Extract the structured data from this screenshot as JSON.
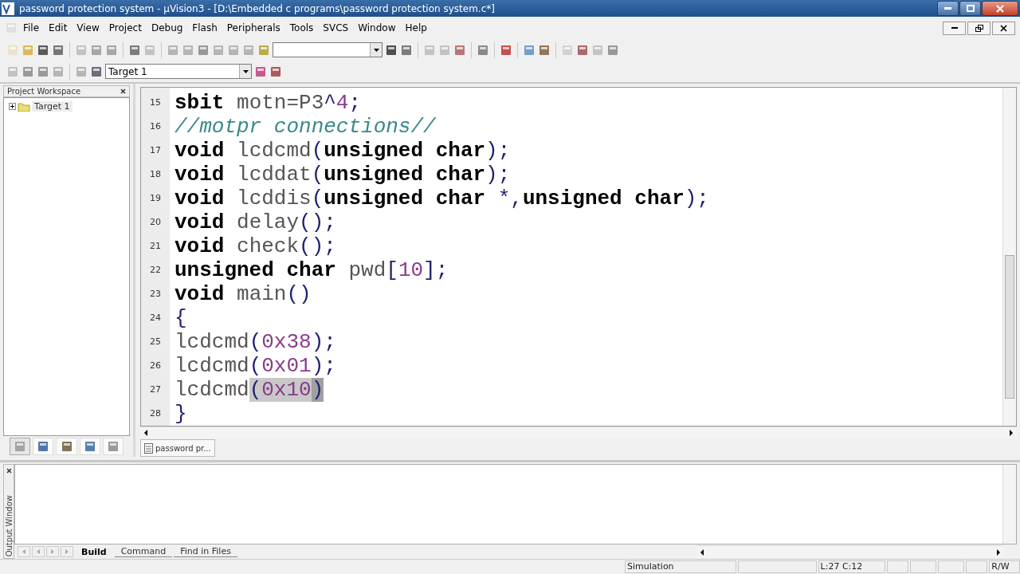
{
  "window": {
    "title": "password protection system  - µVision3 - [D:\\Embedded c programs\\password protection system.c*]"
  },
  "menu": [
    "File",
    "Edit",
    "View",
    "Project",
    "Debug",
    "Flash",
    "Peripherals",
    "Tools",
    "SVCS",
    "Window",
    "Help"
  ],
  "toolbar": {
    "target_select": {
      "value": "Target 1"
    }
  },
  "project_workspace": {
    "title": "Project Workspace",
    "tree": [
      {
        "label": "Target 1",
        "expanded": false
      }
    ],
    "tabs": [
      {
        "kind": "files",
        "selected": true
      },
      {
        "kind": "regs",
        "selected": false
      },
      {
        "kind": "books",
        "selected": false
      },
      {
        "kind": "functions",
        "selected": false
      },
      {
        "kind": "templates",
        "selected": false
      }
    ]
  },
  "editor": {
    "lines": [
      {
        "number": "15",
        "tokens": [
          {
            "text": "sbit",
            "kind": "kw"
          },
          {
            "text": " motn=P3",
            "kind": "id"
          },
          {
            "text": "^",
            "kind": "op"
          },
          {
            "text": "4",
            "kind": "num"
          },
          {
            "text": ";",
            "kind": "op"
          }
        ]
      },
      {
        "number": "16",
        "tokens": [
          {
            "text": "//motpr connections//",
            "kind": "comment"
          }
        ]
      },
      {
        "number": "17",
        "tokens": [
          {
            "text": "void",
            "kind": "kw"
          },
          {
            "text": " lcdcmd",
            "kind": "id"
          },
          {
            "text": "(",
            "kind": "op"
          },
          {
            "text": "unsigned char",
            "kind": "kw"
          },
          {
            "text": ");",
            "kind": "op"
          }
        ]
      },
      {
        "number": "18",
        "tokens": [
          {
            "text": "void",
            "kind": "kw"
          },
          {
            "text": " lcddat",
            "kind": "id"
          },
          {
            "text": "(",
            "kind": "op"
          },
          {
            "text": "unsigned char",
            "kind": "kw"
          },
          {
            "text": ");",
            "kind": "op"
          }
        ]
      },
      {
        "number": "19",
        "tokens": [
          {
            "text": "void",
            "kind": "kw"
          },
          {
            "text": " lcddis",
            "kind": "id"
          },
          {
            "text": "(",
            "kind": "op"
          },
          {
            "text": "unsigned char",
            "kind": "kw"
          },
          {
            "text": " *,",
            "kind": "op"
          },
          {
            "text": "unsigned char",
            "kind": "kw"
          },
          {
            "text": ");",
            "kind": "op"
          }
        ]
      },
      {
        "number": "20",
        "tokens": [
          {
            "text": "void",
            "kind": "kw"
          },
          {
            "text": " delay",
            "kind": "id"
          },
          {
            "text": "();",
            "kind": "op"
          }
        ]
      },
      {
        "number": "21",
        "tokens": [
          {
            "text": "void",
            "kind": "kw"
          },
          {
            "text": " check",
            "kind": "id"
          },
          {
            "text": "();",
            "kind": "op"
          }
        ]
      },
      {
        "number": "22",
        "tokens": [
          {
            "text": "unsigned char",
            "kind": "kw"
          },
          {
            "text": " pwd",
            "kind": "id"
          },
          {
            "text": "[",
            "kind": "op"
          },
          {
            "text": "10",
            "kind": "num"
          },
          {
            "text": "];",
            "kind": "op"
          }
        ]
      },
      {
        "number": "23",
        "tokens": [
          {
            "text": "void",
            "kind": "kw"
          },
          {
            "text": " main",
            "kind": "id"
          },
          {
            "text": "()",
            "kind": "op"
          }
        ]
      },
      {
        "number": "24",
        "tokens": [
          {
            "text": "{",
            "kind": "op"
          }
        ]
      },
      {
        "number": "25",
        "tokens": [
          {
            "text": "lcdcmd",
            "kind": "id"
          },
          {
            "text": "(",
            "kind": "op"
          },
          {
            "text": "0x38",
            "kind": "num"
          },
          {
            "text": ");",
            "kind": "op"
          }
        ]
      },
      {
        "number": "26",
        "tokens": [
          {
            "text": "lcdcmd",
            "kind": "id"
          },
          {
            "text": "(",
            "kind": "op"
          },
          {
            "text": "0x01",
            "kind": "num"
          },
          {
            "text": ");",
            "kind": "op"
          }
        ]
      },
      {
        "number": "27",
        "tokens": [
          {
            "text": "lcdcmd",
            "kind": "id",
            "highlighted": false
          },
          {
            "text": "(",
            "kind": "op",
            "highlighted": true
          },
          {
            "text": "0x10",
            "kind": "num",
            "highlighted": true
          },
          {
            "text": ")",
            "kind": "op",
            "highlighted": true
          }
        ]
      },
      {
        "number": "28",
        "tokens": [
          {
            "text": "}",
            "kind": "op"
          }
        ]
      }
    ],
    "tabs": [
      {
        "label": "password pr...",
        "selected": true
      }
    ]
  },
  "output_window": {
    "title": "Output Window",
    "tabs": [
      {
        "label": "Build",
        "selected": true
      },
      {
        "label": "Command",
        "selected": false
      },
      {
        "label": "Find in Files",
        "selected": false
      }
    ]
  },
  "status_bar": {
    "mode": "Simulation",
    "position": "L:27 C:12",
    "access": "R/W"
  }
}
